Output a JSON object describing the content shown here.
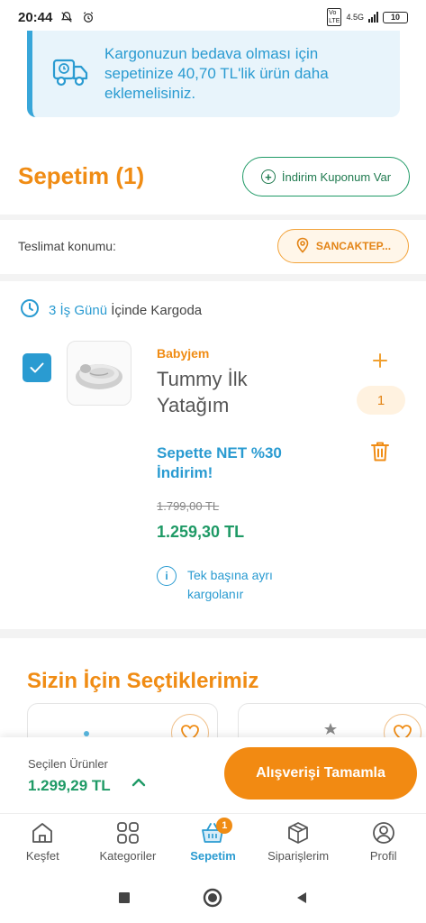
{
  "status_bar": {
    "time": "20:44",
    "network": "4.5G",
    "battery": "10"
  },
  "banner": {
    "text": "Kargonuzun bedava olması için sepetinize 40,70 TL'lik ürün daha eklemelisiniz."
  },
  "header": {
    "title": "Sepetim (1)",
    "coupon_label": "İndirim Kuponum Var"
  },
  "delivery": {
    "label": "Teslimat konumu:",
    "location": "SANCAKTEP..."
  },
  "shipping": {
    "accent": "3 İş Günü",
    "rest": "İçinde Kargoda"
  },
  "product": {
    "brand": "Babyjem",
    "name": "Tummy İlk Yatağım",
    "promo": "Sepette NET %30 İndirim!",
    "old_price": "1.799,00 TL",
    "price": "1.259,30 TL",
    "note": "Tek başına ayrı kargolanır",
    "quantity": "1",
    "checked": true
  },
  "recommendations": {
    "title": "Sizin İçin Seçtiklerimiz"
  },
  "checkout": {
    "selected_label": "Seçilen Ürünler",
    "total": "1.299,29 TL",
    "button_label": "Alışverişi Tamamla"
  },
  "tabs": [
    {
      "label": "Keşfet",
      "icon": "home-icon"
    },
    {
      "label": "Kategoriler",
      "icon": "grid-icon"
    },
    {
      "label": "Sepetim",
      "icon": "basket-icon",
      "badge": "1",
      "active": true
    },
    {
      "label": "Siparişlerim",
      "icon": "box-icon"
    },
    {
      "label": "Profil",
      "icon": "profile-icon"
    }
  ],
  "colors": {
    "orange": "#f08c14",
    "blue": "#2a9bd1",
    "green": "#1f9a66"
  }
}
